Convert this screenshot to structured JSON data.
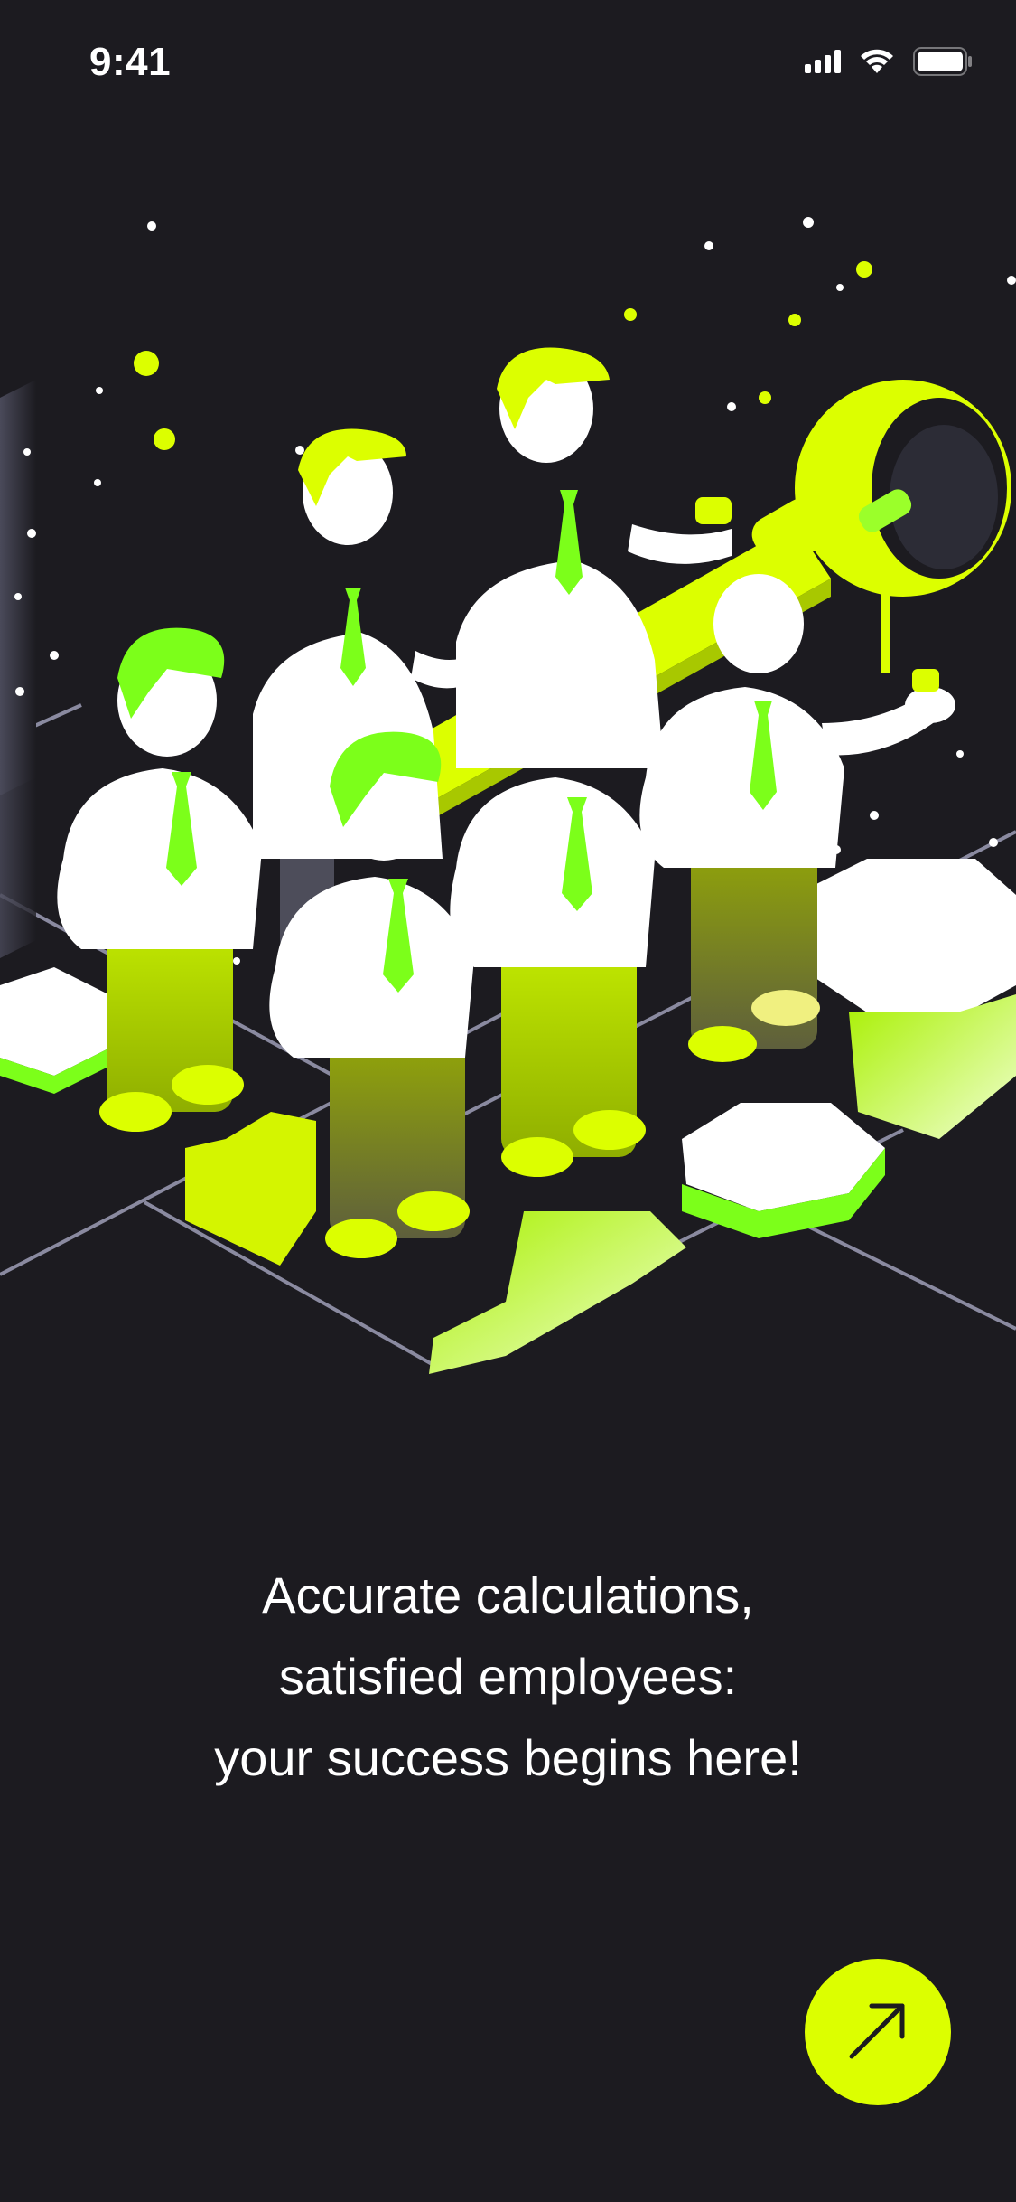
{
  "status_bar": {
    "time": "9:41",
    "icons": [
      "cellular-signal-icon",
      "wifi-icon",
      "battery-icon"
    ]
  },
  "illustration": {
    "description_icon": "team-holding-key-illustration"
  },
  "onboarding": {
    "headline_lines": [
      "Accurate calculations,",
      "satisfied employees:",
      "your success begins here!"
    ]
  },
  "next_button": {
    "icon": "arrow-up-right-icon"
  },
  "colors": {
    "background": "#1c1b20",
    "accent": "#dcff00",
    "accent_green": "#7cff1a",
    "text": "#ffffff"
  }
}
